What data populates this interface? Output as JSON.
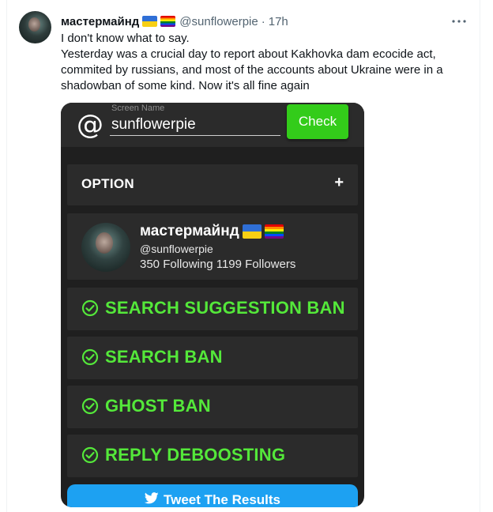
{
  "tweet": {
    "author_name": "мастермайнд",
    "author_handle": "@sunflowerpie",
    "separator": "·",
    "time": "17h",
    "more_icon": "more-horizontal-icon",
    "text_line1": "I don't know what to say.",
    "text_line2": "Yesterday was a crucial day to report about Kakhovka dam ecocide act, commited by russians, and most of the accounts about Ukraine were in a shadowban of some kind. Now it's all fine again"
  },
  "media": {
    "at_symbol": "@",
    "field_label": "Screen Name",
    "field_value": "sunflowerpie",
    "check_label": "Check",
    "option_label": "OPTION",
    "option_toggle": "+",
    "profile": {
      "name": "мастермайнд",
      "handle": "@sunflowerpie",
      "stats": "350 Following 1199 Followers"
    },
    "results": [
      {
        "label": "SEARCH SUGGESTION BAN",
        "status": "ok"
      },
      {
        "label": "SEARCH BAN",
        "status": "ok"
      },
      {
        "label": "GHOST BAN",
        "status": "ok"
      },
      {
        "label": "REPLY DEBOOSTING",
        "status": "ok"
      }
    ],
    "tweet_results_label": "Tweet The Results"
  },
  "colors": {
    "accent_green": "#54e83a",
    "check_button": "#33cc1a",
    "twitter_blue": "#1da1f2",
    "panel_bg": "#2b2b2b"
  }
}
